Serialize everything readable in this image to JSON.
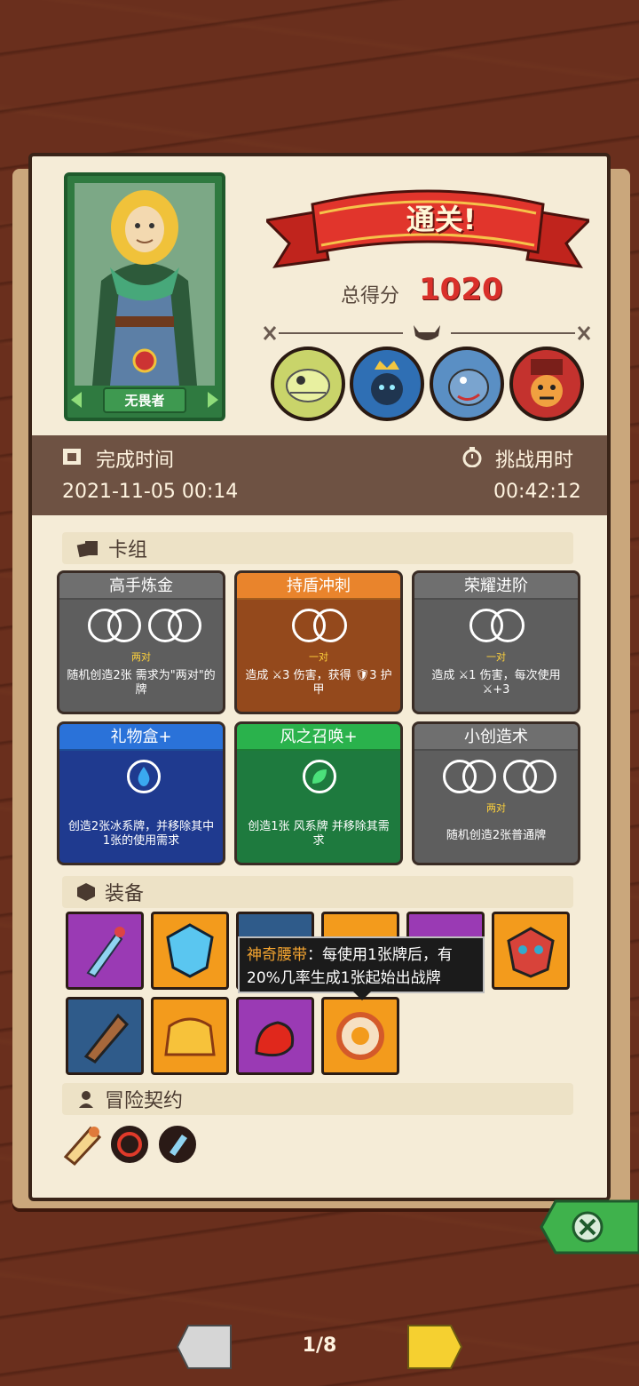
{
  "result": {
    "banner": "通关!",
    "score_label": "总得分",
    "score": "1020"
  },
  "hero": {
    "name": "无畏者"
  },
  "bosses": [
    "dinosaur-skeleton-boss",
    "crowned-spider-boss",
    "blue-beast-boss",
    "jester-boss"
  ],
  "times": {
    "finish_label": "完成时间",
    "finish_value": "2021-11-05 00:14",
    "challenge_label": "挑战用时",
    "challenge_value": "00:42:12"
  },
  "deck": {
    "label": "卡组",
    "cards": [
      {
        "title": "高手炼金",
        "req": "两对",
        "desc": "随机创造2张 需求为\"两对\"的牌"
      },
      {
        "title": "持盾冲刺",
        "req": "一对",
        "desc": "造成 ⚔3 伤害，获得 🛡3 护甲"
      },
      {
        "title": "荣耀进阶",
        "req": "一对",
        "desc": "造成 ⚔1 伤害，每次使用 ⚔+3"
      },
      {
        "title": "礼物盒+",
        "req": "",
        "desc": "创造2张冰系牌，并移除其中1张的使用需求"
      },
      {
        "title": "风之召唤+",
        "req": "",
        "desc": "创造1张 风系牌 并移除其需求"
      },
      {
        "title": "小创造术",
        "req": "两对",
        "desc": "随机创造2张普通牌"
      }
    ]
  },
  "equipment": {
    "label": "装备",
    "tooltip_name": "神奇腰带",
    "tooltip_text": "：每使用1张牌后，有20%几率生成1张起始出战牌"
  },
  "contracts": {
    "label": "冒险契约"
  },
  "pager": {
    "text": "1/8"
  },
  "colors": {
    "gray_card": "#5e5e5e",
    "brown_card": "#94491c",
    "blue_card": "#1f3a8f",
    "green_card": "#1e7a3e"
  }
}
